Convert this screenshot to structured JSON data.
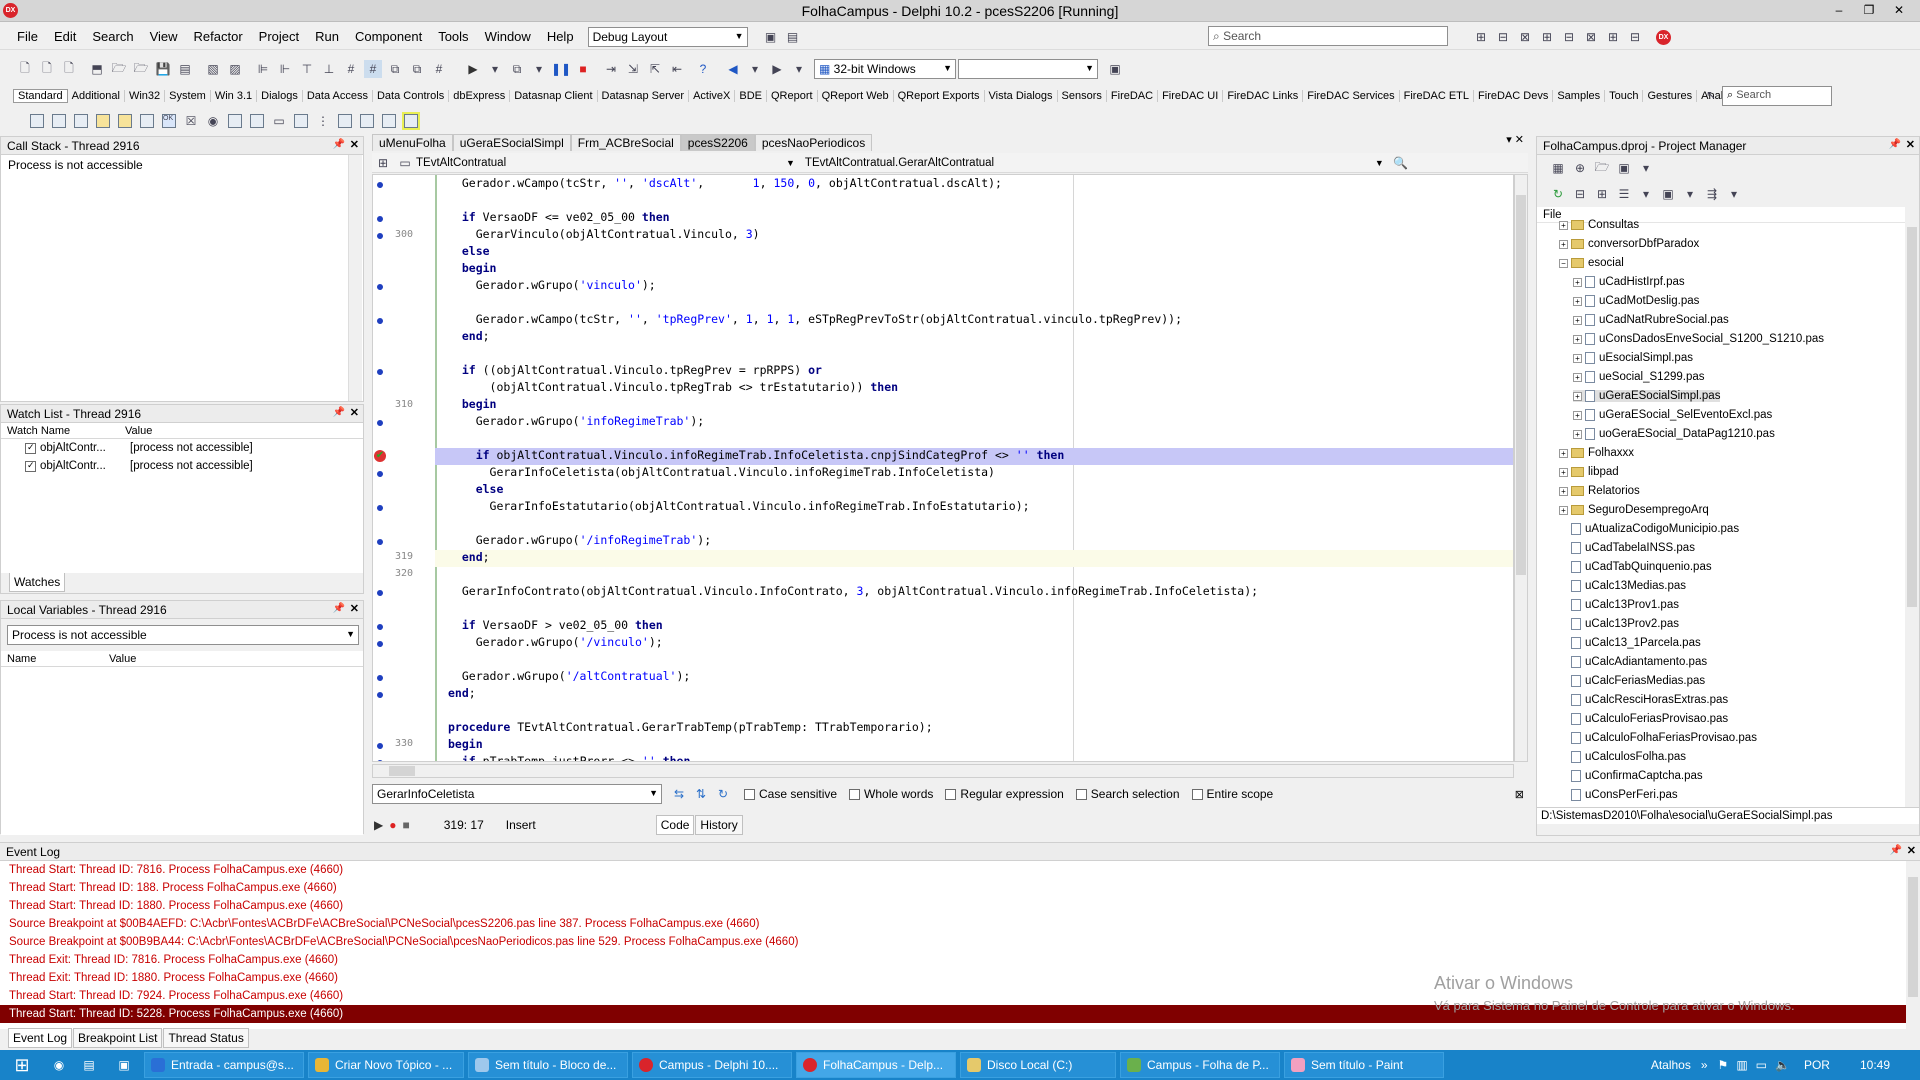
{
  "window": {
    "title": "FolhaCampus - Delphi 10.2 - pcesS2206 [Running]",
    "logo": "DX",
    "buttons": [
      "–",
      "❐",
      "✕"
    ]
  },
  "menu": [
    "File",
    "Edit",
    "Search",
    "View",
    "Refactor",
    "Project",
    "Run",
    "Component",
    "Tools",
    "Window",
    "Help"
  ],
  "toolbar": {
    "layout": "Debug Layout",
    "search_placeholder": "Search",
    "platform": "32-bit Windows"
  },
  "palette": {
    "tabs": [
      "Standard",
      "Additional",
      "Win32",
      "System",
      "Win 3.1",
      "Dialogs",
      "Data Access",
      "Data Controls",
      "dbExpress",
      "Datasnap Client",
      "Datasnap Server",
      "ActiveX",
      "BDE",
      "QReport",
      "QReport Web",
      "QReport Exports",
      "Vista Dialogs",
      "Sensors",
      "FireDAC",
      "FireDAC UI",
      "FireDAC Links",
      "FireDAC Services",
      "FireDAC ETL",
      "FireDAC Devs",
      "Samples",
      "Touch",
      "Gestures",
      "Analytics"
    ],
    "search_placeholder": "Search"
  },
  "callstack": {
    "title": "Call Stack - Thread 2916",
    "message": "Process is not accessible"
  },
  "watch": {
    "title": "Watch List - Thread 2916",
    "col_name": "Watch Name",
    "col_value": "Value",
    "rows": [
      {
        "name": "objAltContr...",
        "value": "[process not accessible]"
      },
      {
        "name": "objAltContr...",
        "value": "[process not accessible]"
      }
    ],
    "tab": "Watches"
  },
  "locals": {
    "title": "Local Variables - Thread 2916",
    "combo": "Process is not accessible",
    "col_name": "Name",
    "col_value": "Value"
  },
  "editor": {
    "tabs": [
      "uMenuFolha",
      "uGeraESocialSimpl",
      "Frm_ACBreSocial",
      "pcesS2206",
      "pcesNaoPeriodicos"
    ],
    "active_tab": "pcesS2206",
    "class_combo": "TEvtAltContratual",
    "method_combo": "TEvtAltContratual.GerarAltContratual",
    "line_numbers": [
      "300",
      "310",
      "319",
      "320",
      "330"
    ],
    "search_text": "GerarInfoCeletista",
    "search_options": [
      "Case sensitive",
      "Whole words",
      "Regular expression",
      "Search selection",
      "Entire scope"
    ],
    "status_pos": "319: 17",
    "status_mode": "Insert",
    "bottom_tabs": [
      "Code",
      "History"
    ]
  },
  "project": {
    "title": "FolhaCampus.dproj - Project Manager",
    "file_label": "File",
    "items": [
      "Consultas",
      "conversorDbfParadox",
      "esocial",
      "uCadHistIrpf.pas",
      "uCadMotDeslig.pas",
      "uCadNatRubreSocial.pas",
      "uConsDadosEnveSocial_S1200_S1210.pas",
      "uEsocialSimpl.pas",
      "ueSocial_S1299.pas",
      "uGeraESocialSimpl.pas",
      "uGeraESocial_SelEventoExcl.pas",
      "uoGeraESocial_DataPag1210.pas",
      "Folhaxxx",
      "libpad",
      "Relatorios",
      "SeguroDesempregoArq",
      "uAtualizaCodigoMunicipio.pas",
      "uCadTabelaINSS.pas",
      "uCadTabQuinquenio.pas",
      "uCalc13Medias.pas",
      "uCalc13Prov1.pas",
      "uCalc13Prov2.pas",
      "uCalc13_1Parcela.pas",
      "uCalcAdiantamento.pas",
      "uCalcFeriasMedias.pas",
      "uCalcResciHorasExtras.pas",
      "uCalculoFeriasProvisao.pas",
      "uCalculoFolhaFeriasProvisao.pas",
      "uCalculosFolha.pas",
      "uConfirmaCaptcha.pas",
      "uConsPerFeri.pas"
    ],
    "path": "D:\\SistemasD2010\\Folha\\esocial\\uGeraESocialSimpl.pas"
  },
  "eventlog": {
    "title": "Event Log",
    "lines": [
      "Thread Start: Thread ID: 7816. Process FolhaCampus.exe (4660)",
      "Thread Start: Thread ID: 188. Process FolhaCampus.exe (4660)",
      "Thread Start: Thread ID: 1880. Process FolhaCampus.exe (4660)",
      "Source Breakpoint at $00B4AEFD: C:\\Acbr\\Fontes\\ACBrDFe\\ACBreSocial\\PCNeSocial\\pcesS2206.pas line 387. Process FolhaCampus.exe (4660)",
      "Source Breakpoint at $00B9BA44: C:\\Acbr\\Fontes\\ACBrDFe\\ACBreSocial\\PCNeSocial\\pcesNaoPeriodicos.pas line 529. Process FolhaCampus.exe (4660)",
      "Thread Exit: Thread ID: 7816. Process FolhaCampus.exe (4660)",
      "Thread Exit: Thread ID: 1880. Process FolhaCampus.exe (4660)",
      "Thread Start: Thread ID: 7924. Process FolhaCampus.exe (4660)",
      "Thread Start: Thread ID: 5228. Process FolhaCampus.exe (4660)"
    ],
    "tabs": [
      "Event Log",
      "Breakpoint List",
      "Thread Status"
    ],
    "watermark_title": "Ativar o Windows",
    "watermark_sub": "Vá para Sistema no Painel de Controle para ativar o Windows."
  },
  "taskbar": {
    "tasks": [
      "Entrada - campus@s...",
      "Criar Novo Tópico - ...",
      "Sem título - Bloco de...",
      "Campus - Delphi 10....",
      "FolhaCampus - Delp...",
      "Disco Local (C:)",
      "Campus - Folha de P...",
      "Sem título - Paint"
    ],
    "tray_label": "Atalhos",
    "lang": "POR",
    "time": "10:49"
  }
}
